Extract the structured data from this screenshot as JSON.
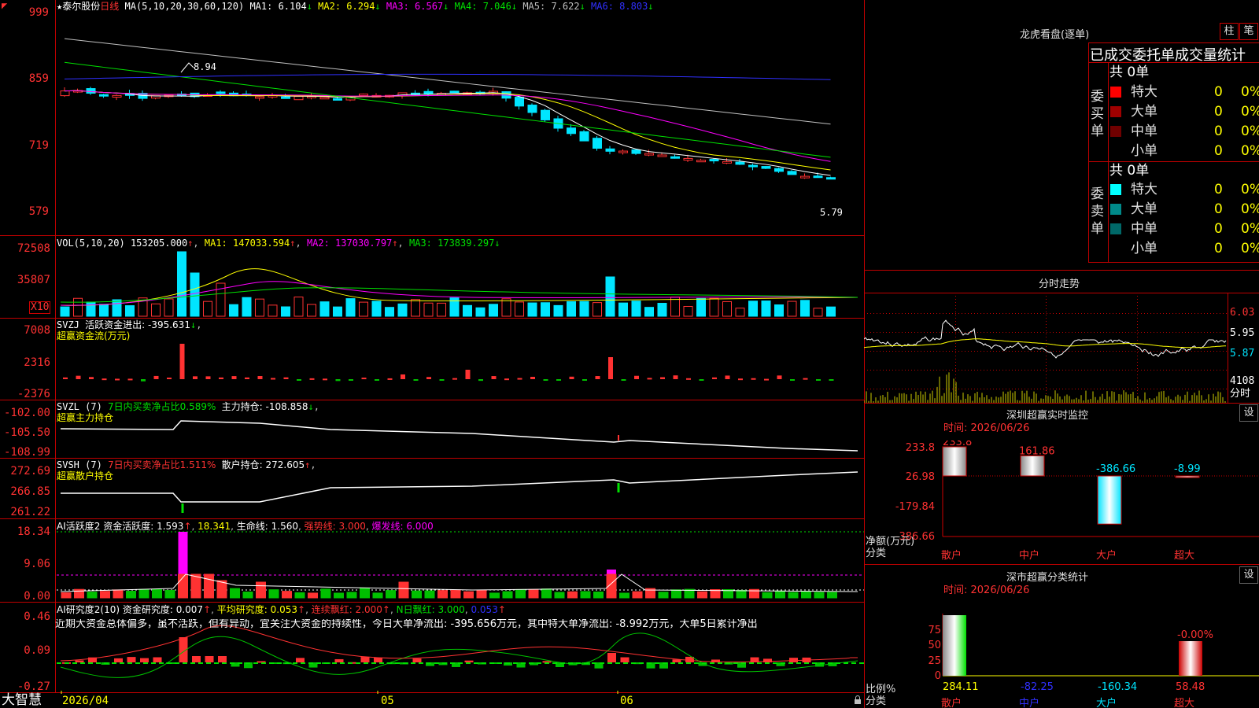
{
  "app": {
    "logo": "大智慧",
    "corner_icon": "red-triangle-icon",
    "lock_icon": "lock-icon"
  },
  "colors": {
    "up": "#ff3232",
    "down": "#00e5ff",
    "grid": "#c00000",
    "ma1": "#ffffff",
    "ma2": "#ffff00",
    "ma3": "#ff00ff",
    "ma4": "#00e000",
    "ma5": "#c0c0c0",
    "ma6": "#3030ff"
  },
  "main": {
    "title_star": "★",
    "stock_name": "泰尔股份",
    "period": "日线",
    "ma_label": "MA(5,10,20,30,60,120)",
    "ma": [
      {
        "label": "MA1: 6.104",
        "arrow": "↓"
      },
      {
        "label": "MA2: 6.294",
        "arrow": "↓"
      },
      {
        "label": "MA3: 6.567",
        "arrow": "↓"
      },
      {
        "label": "MA4: 7.046",
        "arrow": "↓"
      },
      {
        "label": "MA5: 7.622",
        "arrow": "↓"
      },
      {
        "label": "MA6: 8.803",
        "arrow": "↓"
      }
    ],
    "y_ticks": [
      "999",
      "859",
      "719",
      "579"
    ],
    "high_mark": "8.94",
    "low_mark": "5.79"
  },
  "volume": {
    "label": "VOL(5,10,20)",
    "value": "153205.000",
    "ma": [
      {
        "label": "MA1: 147033.594",
        "arrow": "↑"
      },
      {
        "label": "MA2: 137030.797",
        "arrow": "↑"
      },
      {
        "label": "MA3: 173839.297",
        "arrow": "↓"
      }
    ],
    "y_ticks": [
      "72508",
      "35807"
    ],
    "unit": "X10"
  },
  "svzj": {
    "label": "SVZJ",
    "line": "活跃资金进出: -395.631",
    "arrow": "↓",
    "subtitle": "超赢资金流(万元)",
    "y_ticks": [
      "7008",
      "2316",
      "-2376"
    ]
  },
  "svzl": {
    "label": "SVZL (7)",
    "ratio": "7日内买卖净占比0.589%",
    "hold": "主力持仓: -108.858",
    "arrow": "↓",
    "subtitle": "超赢主力持仓",
    "y_ticks": [
      "-102.00",
      "-105.50",
      "-108.99"
    ]
  },
  "svsh": {
    "label": "SVSH (7)",
    "ratio": "7日内买卖净占比1.511%",
    "hold": "散户持仓: 272.605",
    "arrow": "↑",
    "subtitle": "超赢散户持仓",
    "y_ticks": [
      "272.69",
      "266.85",
      "261.22"
    ]
  },
  "ai_active": {
    "label": "AI活跃度2",
    "active": "资金活跃度: 1.593",
    "arrow": "↑",
    "v2": "18.341",
    "life": "生命线: 1.560",
    "strong": "强势线: 3.000",
    "burst": "爆发线: 6.000",
    "y_ticks": [
      "18.34",
      "9.06",
      "0.00"
    ]
  },
  "ai_research": {
    "label": "AI研究度2(10)",
    "research": "资金研究度: 0.007",
    "avg": "平均研究度: 0.053",
    "red": "连续飘红: 2.000",
    "nday": "N日飘红: 3.000",
    "v5": "0.053",
    "comment": "近期大资金总体偏多，虽不活跃，但有异动，宜关注大资金的持续性，今日大单净流出: -395.656万元，其中特大单净流出: -8.992万元，大单5日累计净出",
    "y_ticks": [
      "0.46",
      "0.09",
      "-0.27"
    ]
  },
  "time_axis": [
    "2026/04",
    "05",
    "06"
  ],
  "lhb": {
    "title": "龙虎看盘(逐单)",
    "btn1": "柱",
    "btn2": "笔",
    "tabs": "已成交委托单成交量统计",
    "buy": {
      "side_label": "委买单",
      "total": "共 0单",
      "rows": [
        {
          "name": "特大",
          "count": "0",
          "pct": "0%",
          "color": "#ff0000"
        },
        {
          "name": "大单",
          "count": "0",
          "pct": "0%",
          "color": "#a00000"
        },
        {
          "name": "中单",
          "count": "0",
          "pct": "0%",
          "color": "#700000"
        },
        {
          "name": "小单",
          "count": "0",
          "pct": "0%",
          "color": ""
        }
      ]
    },
    "sell": {
      "side_label": "委卖单",
      "total": "共 0单",
      "rows": [
        {
          "name": "特大",
          "count": "0",
          "pct": "0%",
          "color": "#00ffff"
        },
        {
          "name": "大单",
          "count": "0",
          "pct": "0%",
          "color": "#008a8a"
        },
        {
          "name": "中单",
          "count": "0",
          "pct": "0%",
          "color": "#006868"
        },
        {
          "name": "小单",
          "count": "0",
          "pct": "0%",
          "color": ""
        }
      ]
    }
  },
  "intraday": {
    "title": "分时走势",
    "prices": [
      "6.03",
      "5.95",
      "5.87"
    ],
    "vol": "4108",
    "unit": "分时"
  },
  "sz_monitor": {
    "title": "深圳超赢实时监控",
    "btn": "设",
    "time": "时间: 2026/06/26",
    "y_ticks": [
      "233.8",
      "26.98",
      "-179.84",
      "-386.66"
    ],
    "ylabel": "净额(万元)",
    "xlabel": "分类",
    "values": [
      "233.8",
      "161.86",
      "-386.66",
      "-8.99"
    ],
    "categories": [
      "散户",
      "中户",
      "大户",
      "超大"
    ]
  },
  "sz_class": {
    "title": "深市超赢分类统计",
    "btn": "设",
    "time": "时间: 2026/06/26",
    "y_ticks": [
      "75",
      "50",
      "25",
      "0"
    ],
    "ylabel": "比例%",
    "xlabel": "分类",
    "top_label": "-0.00%",
    "values": [
      "284.11",
      "-82.25",
      "-160.34",
      "58.48"
    ],
    "categories": [
      "散户",
      "中户",
      "大户",
      "超大"
    ]
  }
}
